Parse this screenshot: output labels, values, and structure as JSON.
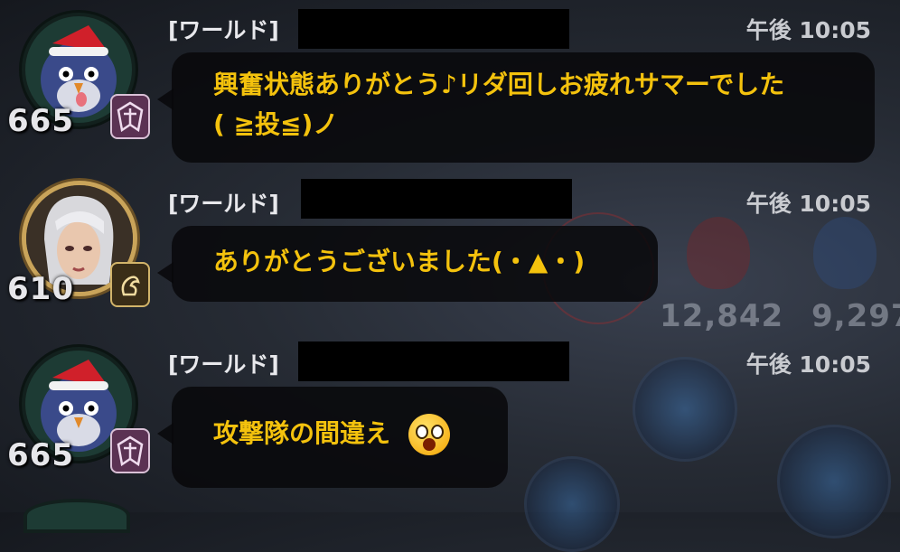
{
  "background": {
    "stats_left": "12,842",
    "stats_right": "9,297"
  },
  "messages": [
    {
      "channel": "[ワールド]",
      "time": "午後 10:05",
      "level": "665",
      "avatar": "penguin-santa-avatar",
      "badge": "guild-crest-badge",
      "text_line1": "興奮状態ありがとう♪リダ回しお疲れサマーでした",
      "text_line2": "( ≧投≦)ノ"
    },
    {
      "channel": "[ワールド]",
      "time": "午後 10:05",
      "level": "610",
      "avatar": "silver-hair-hero-avatar",
      "badge": "dragon-crest-badge",
      "text_line1": "ありがとうございました(・▲・)"
    },
    {
      "channel": "[ワールド]",
      "time": "午後 10:05",
      "level": "665",
      "avatar": "penguin-santa-avatar",
      "badge": "guild-crest-badge",
      "text_line1": "攻撃隊の間違え",
      "emoji": "shocked-face-emoji"
    }
  ],
  "colors": {
    "message_text": "#f4c20d",
    "bubble_bg": "#08080a",
    "channel_text": "#e8e8ec",
    "time_text": "#c9cbd0"
  }
}
